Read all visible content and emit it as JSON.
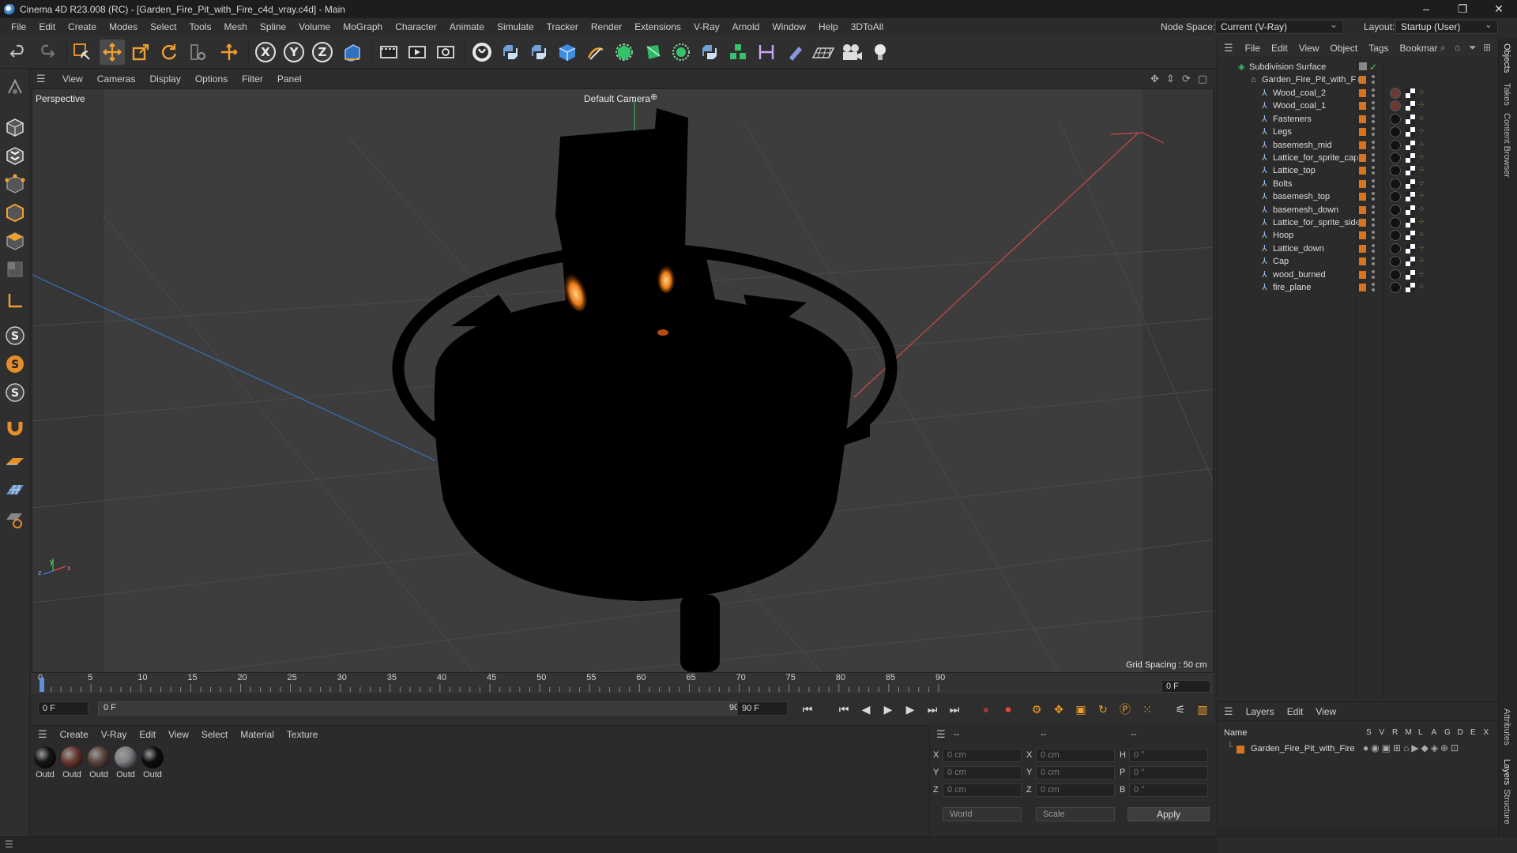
{
  "window": {
    "title": "Cinema 4D R23.008 (RC) - [Garden_Fire_Pit_with_Fire_c4d_vray.c4d] - Main",
    "controls": [
      "–",
      "❐",
      "✕"
    ]
  },
  "menubar": {
    "items": [
      "File",
      "Edit",
      "Create",
      "Modes",
      "Select",
      "Tools",
      "Mesh",
      "Spline",
      "Volume",
      "MoGraph",
      "Character",
      "Animate",
      "Simulate",
      "Tracker",
      "Render",
      "Extensions",
      "V-Ray",
      "Arnold",
      "Window",
      "Help",
      "3DToAll"
    ],
    "node_space_label": "Node Space:",
    "node_space_value": "Current (V-Ray)",
    "layout_label": "Layout:",
    "layout_value": "Startup (User)"
  },
  "viewport": {
    "menu": [
      "View",
      "Cameras",
      "Display",
      "Options",
      "Filter",
      "Panel"
    ],
    "view_name": "Perspective",
    "camera": "Default Camera",
    "grid_spacing": "Grid Spacing : 50 cm",
    "axes": {
      "x": "x",
      "y": "y",
      "z": "z"
    }
  },
  "timeline": {
    "ticks": [
      "0",
      "5",
      "10",
      "15",
      "20",
      "25",
      "30",
      "35",
      "40",
      "45",
      "50",
      "55",
      "60",
      "65",
      "70",
      "75",
      "80",
      "85",
      "90"
    ],
    "current_frame": "0 F",
    "start_field": "0 F",
    "range_start": "0 F",
    "range_end": "90 F",
    "end_field": "90 F"
  },
  "materials": {
    "menu": [
      "Create",
      "V-Ray",
      "Edit",
      "View",
      "Select",
      "Material",
      "Texture"
    ],
    "items": [
      {
        "label": "Outd",
        "color": "#141414"
      },
      {
        "label": "Outd",
        "color": "#6b3a32"
      },
      {
        "label": "Outd",
        "color": "#5b4540"
      },
      {
        "label": "Outd",
        "color": "#7d8084"
      },
      {
        "label": "Outd",
        "color": "#0e0e0e"
      }
    ]
  },
  "attributes": {
    "header_left": "--",
    "header_mid": "--",
    "header_right": "--",
    "rows": [
      {
        "a": "X",
        "av": "0 cm",
        "b": "X",
        "bv": "0 cm",
        "c": "H",
        "cv": "0 °"
      },
      {
        "a": "Y",
        "av": "0 cm",
        "b": "Y",
        "bv": "0 cm",
        "c": "P",
        "cv": "0 °"
      },
      {
        "a": "Z",
        "av": "0 cm",
        "b": "Z",
        "bv": "0 cm",
        "c": "B",
        "cv": "0 °"
      }
    ],
    "coord_mode": "World",
    "scale_mode": "Scale",
    "apply": "Apply"
  },
  "objects": {
    "menu": [
      "File",
      "Edit",
      "View",
      "Object",
      "Tags",
      "Bookmar"
    ],
    "root": "Subdivision Surface",
    "group": "Garden_Fire_Pit_with_Fire",
    "children": [
      "Wood_coal_2",
      "Wood_coal_1",
      "Fasteners",
      "Legs",
      "basemesh_mid",
      "Lattice_for_sprite_cap",
      "Lattice_top",
      "Bolts",
      "basemesh_top",
      "basemesh_down",
      "Lattice_for_sprite_side",
      "Hoop",
      "Lattice_down",
      "Cap",
      "wood_burned",
      "fire_plane"
    ]
  },
  "layers": {
    "menu": [
      "Layers",
      "Edit",
      "View"
    ],
    "name_header": "Name",
    "flags": [
      "S",
      "V",
      "R",
      "M",
      "L",
      "A",
      "G",
      "D",
      "E",
      "X"
    ],
    "items": [
      "Garden_Fire_Pit_with_Fire"
    ]
  },
  "right_tabs": [
    "Objects",
    "Takes",
    "Content Browser",
    "Attributes",
    "Layers",
    "Structure"
  ],
  "colors": {
    "accent": "#d9741e",
    "panel": "#2b2b2b",
    "viewport": "#3d3d3d"
  }
}
